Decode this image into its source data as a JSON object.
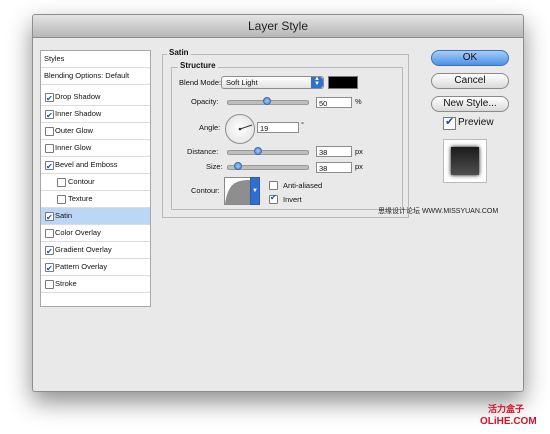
{
  "dialog": {
    "title": "Layer Style",
    "styles_list": [
      {
        "label": "Styles",
        "checkbox": false,
        "checked": false,
        "selected": false
      },
      {
        "label": "Blending Options: Default",
        "checkbox": false,
        "checked": false,
        "selected": false
      },
      {
        "label": "Drop Shadow",
        "checkbox": true,
        "checked": true,
        "selected": false
      },
      {
        "label": "Inner Shadow",
        "checkbox": true,
        "checked": true,
        "selected": false
      },
      {
        "label": "Outer Glow",
        "checkbox": true,
        "checked": false,
        "selected": false
      },
      {
        "label": "Inner Glow",
        "checkbox": true,
        "checked": false,
        "selected": false
      },
      {
        "label": "Bevel and Emboss",
        "checkbox": true,
        "checked": true,
        "selected": false
      },
      {
        "label": "Contour",
        "checkbox": true,
        "checked": false,
        "selected": false
      },
      {
        "label": "Texture",
        "checkbox": true,
        "checked": false,
        "selected": false
      },
      {
        "label": "Satin",
        "checkbox": true,
        "checked": true,
        "selected": true
      },
      {
        "label": "Color Overlay",
        "checkbox": true,
        "checked": false,
        "selected": false
      },
      {
        "label": "Gradient Overlay",
        "checkbox": true,
        "checked": true,
        "selected": false
      },
      {
        "label": "Pattern Overlay",
        "checkbox": true,
        "checked": true,
        "selected": false
      },
      {
        "label": "Stroke",
        "checkbox": true,
        "checked": false,
        "selected": false
      }
    ],
    "satin": {
      "group_label": "Satin",
      "structure_label": "Structure",
      "blend_mode_label": "Blend Mode:",
      "blend_mode_value": "Soft Light",
      "blend_color": "#000000",
      "opacity_label": "Opacity:",
      "opacity_value": "50",
      "opacity_unit": "%",
      "opacity_fraction": 0.5,
      "angle_label": "Angle:",
      "angle_value": "19",
      "angle_unit": "°",
      "distance_label": "Distance:",
      "distance_value": "38",
      "distance_unit": "px",
      "size_label": "Size:",
      "size_value": "38",
      "size_unit": "px",
      "contour_label": "Contour:",
      "anti_aliased_label": "Anti-aliased",
      "anti_aliased_checked": false,
      "invert_label": "Invert",
      "invert_checked": true
    },
    "buttons": {
      "ok": "OK",
      "cancel": "Cancel",
      "new_style": "New Style...",
      "preview_label": "Preview",
      "preview_checked": true
    }
  },
  "watermarks": {
    "site_line": "思缘设计论坛 WWW.MISSYUAN.COM",
    "brand_cn": "活力盒子",
    "brand_en": "OLiHE.COM"
  },
  "colors": {
    "accent": "#2f6fd0",
    "selection": "#bcd6f6",
    "watermark": "#d2142a"
  }
}
